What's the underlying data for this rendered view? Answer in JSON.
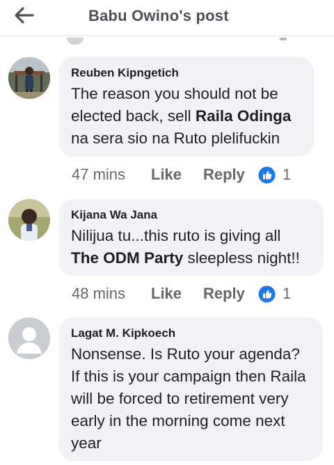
{
  "header": {
    "title": "Babu Owino's post"
  },
  "comments": [
    {
      "author": "Reuben Kipngetich",
      "text_parts": [
        "The reason you should not be elected back, sell ",
        "Raila Odinga",
        " na sera sio na Ruto plelifuckin"
      ],
      "time": "47 mins",
      "like_label": "Like",
      "reply_label": "Reply",
      "reactions": "1"
    },
    {
      "author": "Kijana Wa Jana",
      "text_parts": [
        "Nilijua tu...this ruto is giving all ",
        "The ODM Party",
        " sleepless night!!"
      ],
      "time": "48 mins",
      "like_label": "Like",
      "reply_label": "Reply",
      "reactions": "1"
    },
    {
      "author": "Lagat M. Kipkoech",
      "text": "Nonsense. Is Ruto your agenda? If this is your campaign then Raila will be forced to retirement very early in the morning come next year"
    }
  ],
  "colors": {
    "bubble": "#f0f2f5",
    "like_blue": "#1877f2",
    "meta_gray": "#65676b"
  },
  "icons": [
    "back-arrow-icon",
    "thumbs-up-icon",
    "default-avatar-icon"
  ]
}
